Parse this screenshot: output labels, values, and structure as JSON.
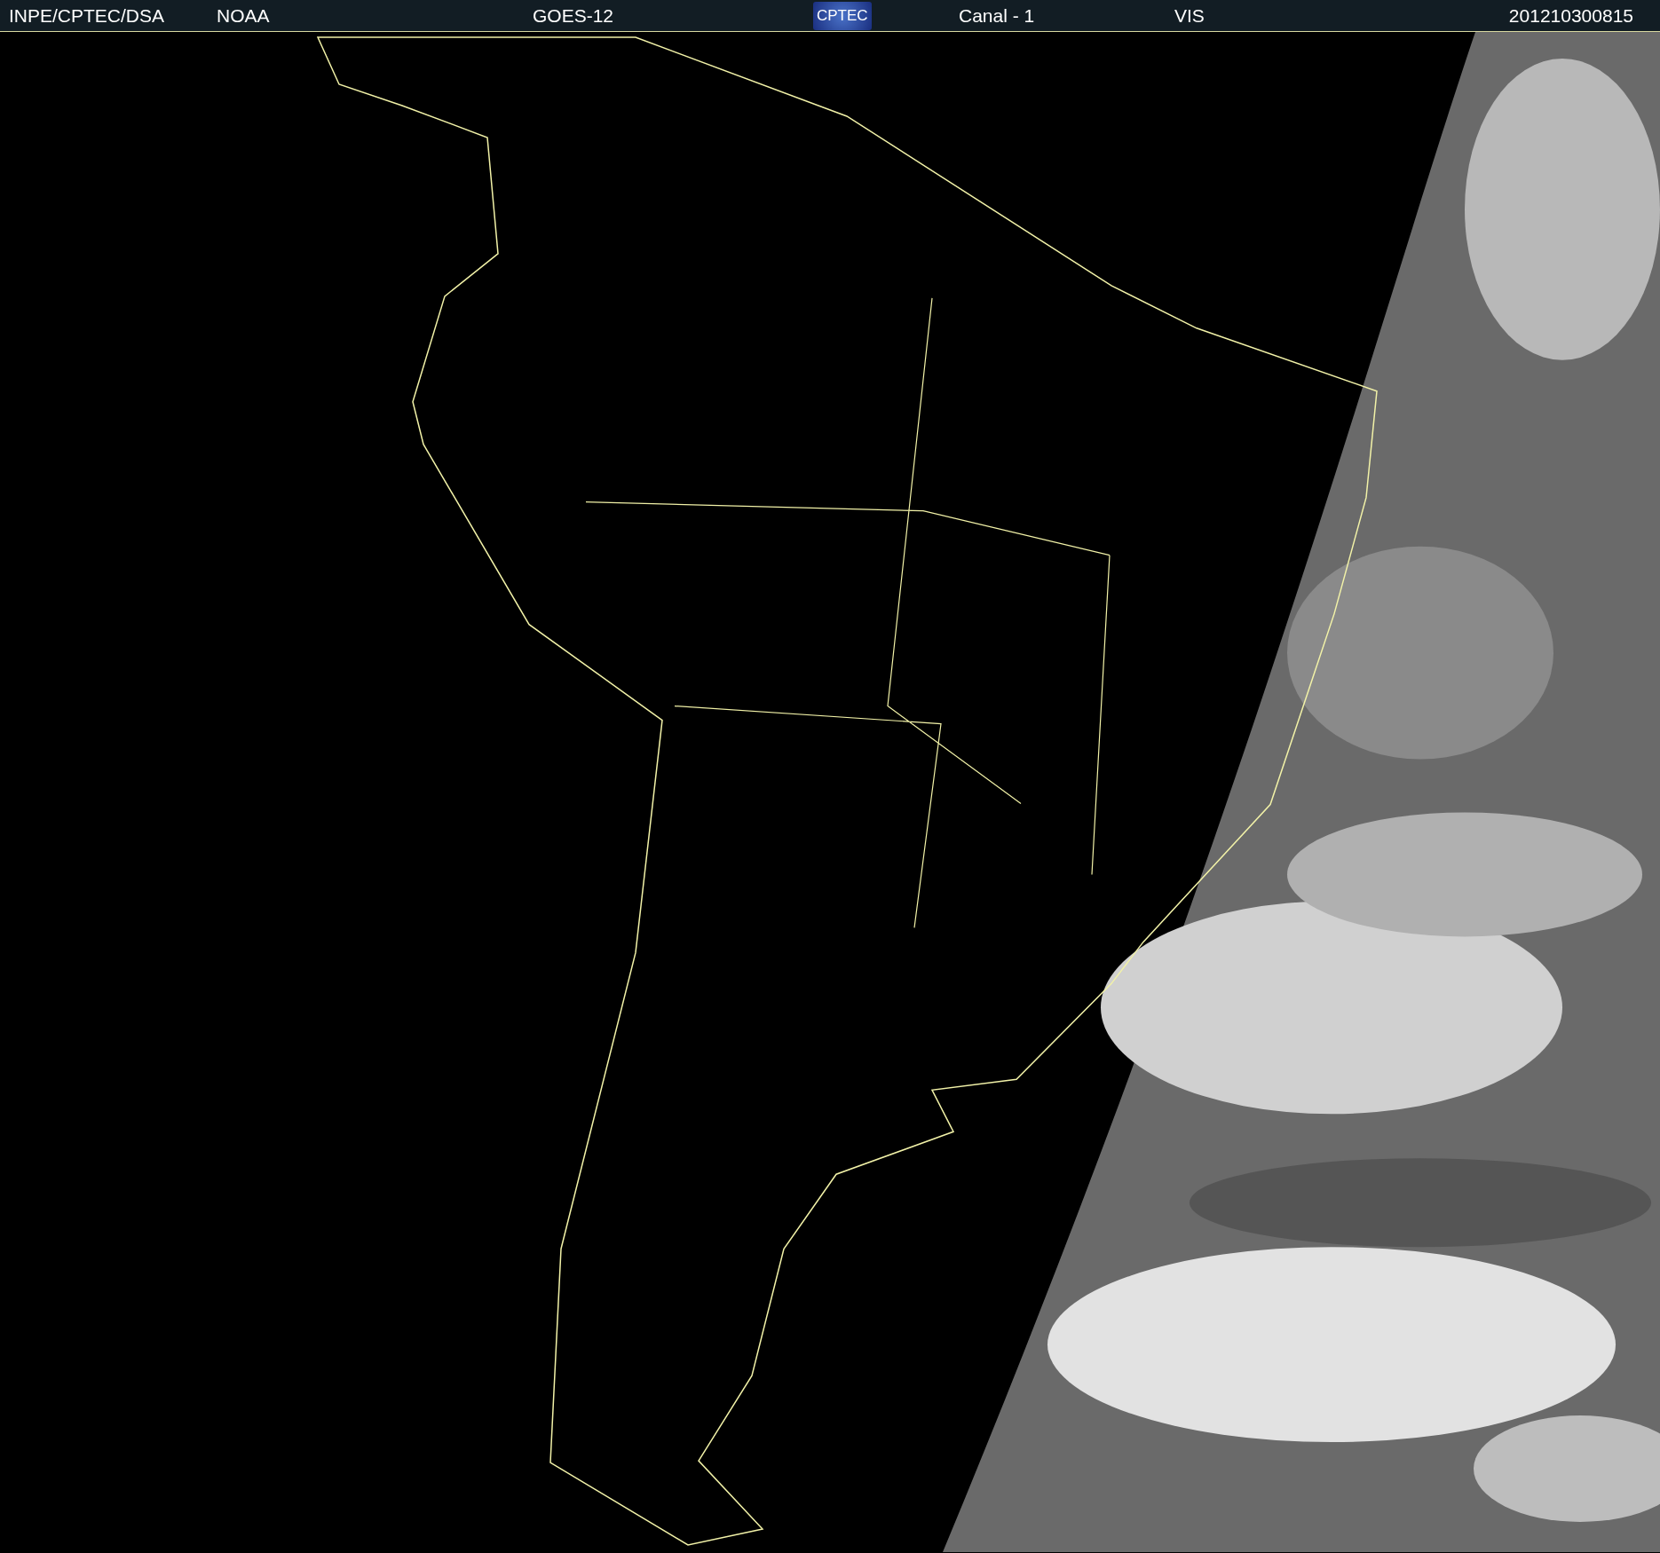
{
  "header": {
    "items": [
      {
        "kind": "text",
        "text": "INPE/CPTEC/DSA"
      },
      {
        "kind": "text",
        "text": "NOAA"
      },
      {
        "kind": "text",
        "text": "GOES-12"
      },
      {
        "kind": "logo",
        "text": "CPTEC"
      },
      {
        "kind": "text",
        "text": "Canal - 1"
      },
      {
        "kind": "text",
        "text": "VIS"
      },
      {
        "kind": "text",
        "text": "201210300815"
      }
    ]
  }
}
